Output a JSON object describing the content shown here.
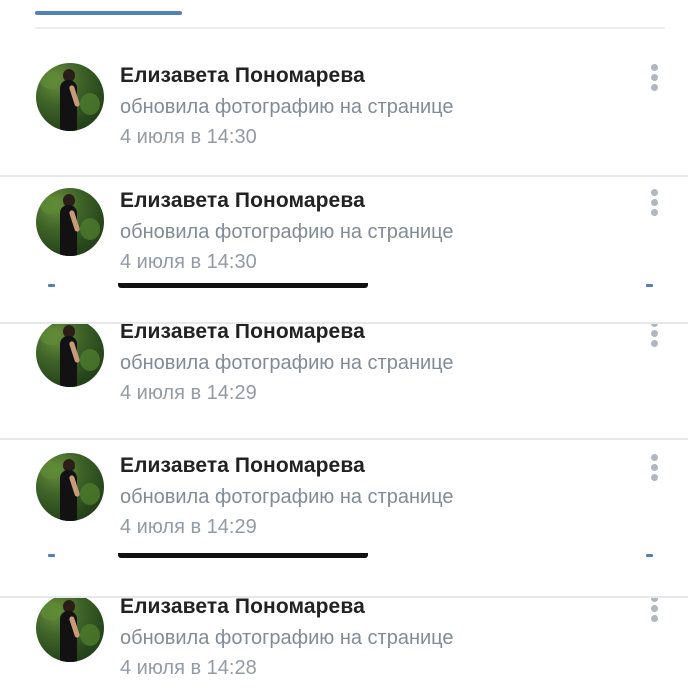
{
  "feed": {
    "items": [
      {
        "name": "Елизавета Пономарева",
        "action": "обновила фотографию на странице",
        "time": "4 июля в 14:30",
        "avatar_icon": "avatar-photo"
      },
      {
        "name": "Елизавета Пономарева",
        "action": "обновила фотографию на странице",
        "time": "4 июля в 14:30",
        "avatar_icon": "avatar-photo"
      },
      {
        "name": "Елизавета Пономарева",
        "action": "обновила фотографию на странице",
        "time": "4 июля в 14:29",
        "avatar_icon": "avatar-photo"
      },
      {
        "name": "Елизавета Пономарева",
        "action": "обновила фотографию на странице",
        "time": "4 июля в 14:29",
        "avatar_icon": "avatar-photo"
      },
      {
        "name": "Елизавета Пономарева",
        "action": "обновила фотографию на странице",
        "time": "4 июля в 14:28",
        "avatar_icon": "avatar-photo"
      }
    ],
    "more_icon": "more-vertical-icon"
  },
  "colors": {
    "accent": "#5181b8",
    "name_text": "#222222",
    "secondary_text": "#828a99",
    "time_text": "#939aa6",
    "divider": "#e6e8eb",
    "more_dots": "#aeb7c2"
  }
}
